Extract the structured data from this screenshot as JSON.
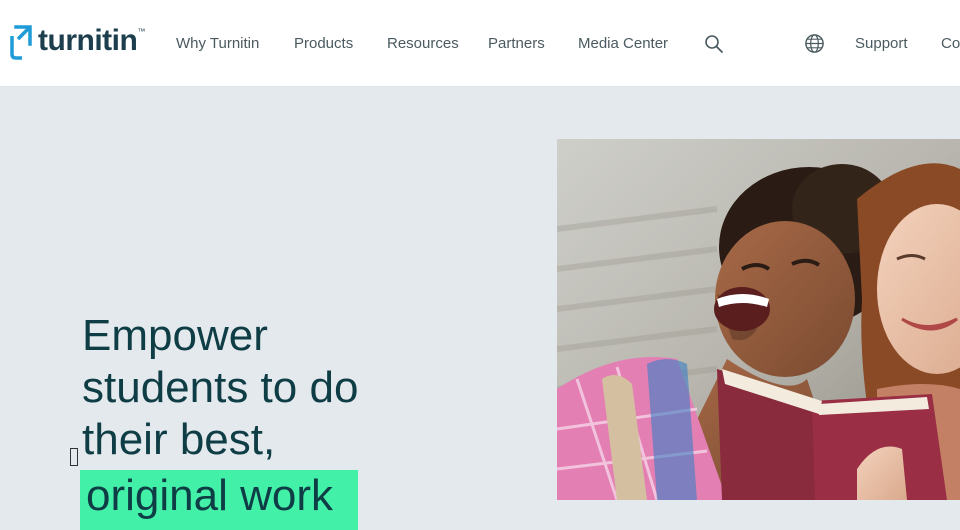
{
  "header": {
    "logo_text": "turnitin",
    "logo_tm": "™",
    "nav": [
      {
        "label": "Why Turnitin"
      },
      {
        "label": "Products"
      },
      {
        "label": "Resources"
      },
      {
        "label": "Partners"
      },
      {
        "label": "Media Center"
      }
    ],
    "support_label": "Support",
    "contact_label": "Co"
  },
  "hero": {
    "headline_lines": [
      "Empower",
      "students to do",
      "their best,"
    ],
    "highlight_text": "original work"
  },
  "colors": {
    "brand_blue": "#1f9bd7",
    "text_dark": "#0f3d45",
    "highlight": "#43f0a8",
    "hero_bg": "#e3e9ec"
  },
  "icons": {
    "logo": "turnitin-logo-icon",
    "search": "search-icon",
    "language": "globe-icon"
  }
}
